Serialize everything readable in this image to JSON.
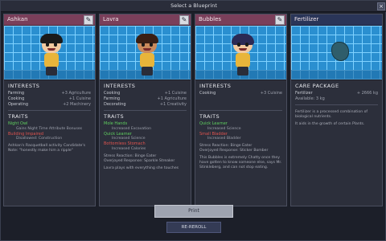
{
  "window": {
    "title": "Select a Blueprint",
    "close_glyph": "×"
  },
  "edit_icon_glyph": "✎",
  "cards": [
    {
      "name": "Ashkan",
      "hair_color": "#1a1a1a",
      "shirt_color": "#e8b53a",
      "interests": [
        {
          "label": "Farming",
          "value": "+3 Agriculture"
        },
        {
          "label": "Cooking",
          "value": "+1 Cuisine"
        },
        {
          "label": "Operating",
          "value": "+2 Machinery"
        }
      ],
      "traits": [
        {
          "name": "Night Owl",
          "kind": "good",
          "sub": "Gains Night Time Attribute Bonuses"
        },
        {
          "name": "Building Impaired",
          "kind": "bad",
          "sub": "Disallowed: Construction"
        }
      ],
      "notes": [
        "Ashkan's Racquetball activity Candidate's Note: \"honestly make him a ripple\""
      ]
    },
    {
      "name": "Lavra",
      "hair_color": "#3a1f14",
      "shirt_color": "#e8b53a",
      "interests": [
        {
          "label": "Cooking",
          "value": "+1 Cuisine"
        },
        {
          "label": "Farming",
          "value": "+1 Agriculture"
        },
        {
          "label": "Decorating",
          "value": "+1 Creativity"
        }
      ],
      "traits": [
        {
          "name": "Mole Hands",
          "kind": "good",
          "sub": "Increased Excavation"
        },
        {
          "name": "Quick Learner",
          "kind": "good",
          "sub": "Increased Science"
        },
        {
          "name": "Bottomless Stomach",
          "kind": "bad",
          "sub": "Increased Calories"
        }
      ],
      "notes": [
        "Stress Reaction: Binge Eater",
        "Overjoyed Response: Sparkle Streaker",
        "Lavra plays with everything she touches"
      ]
    },
    {
      "name": "Bubbles",
      "hair_color": "#2b2a55",
      "shirt_color": "#e8b53a",
      "interests": [
        {
          "label": "Cooking",
          "value": "+3 Cuisine"
        }
      ],
      "traits": [
        {
          "name": "Quick Learner",
          "kind": "good",
          "sub": "Increased Science"
        },
        {
          "name": "Small Bladder",
          "kind": "bad",
          "sub": "Increased Bladder"
        }
      ],
      "notes": [
        "Stress Reaction: Binge Eater",
        "Overjoyed Response: Sticker Bomber",
        "This Bubbles is extremely Chatty once they have gotten to know someone else, says Mr. Stinkleberg, and can not stop eating."
      ]
    },
    {
      "name": "Fertilizer",
      "care_title": "CARE PACKAGE",
      "care_rows": [
        {
          "label": "Fertilizer",
          "value": "+ 2666 kg"
        },
        {
          "label": "Available: 3 kg",
          "value": ""
        }
      ],
      "care_text": [
        "Fertilizer is a processed combination of biological nutrients.",
        "It aids in the growth of certain Plants."
      ]
    }
  ],
  "labels": {
    "interests": "INTERESTS",
    "traits": "TRAITS"
  },
  "buttons": {
    "print": "Print",
    "reroll": "RE-REROLL"
  }
}
